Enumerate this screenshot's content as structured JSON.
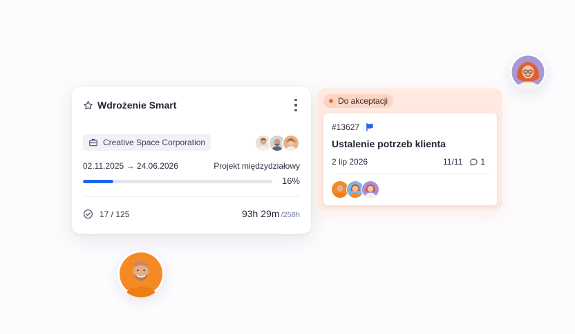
{
  "project": {
    "title": "Wdrożenie Smart",
    "client": "Creative Space Corporation",
    "dates": "02.11.2025 → 24.06.2026",
    "department": "Projekt międzydziałowy",
    "progress_fraction": 0.16,
    "progress_label": "16%",
    "tasks": "17 / 125",
    "time_spent": "93h 29m",
    "time_total": "/258h",
    "icons": [
      "star-icon",
      "menu-kebab-icon",
      "briefcase-icon",
      "check-circle-icon"
    ],
    "accent_color": "#2165e8"
  },
  "status_column": {
    "label": "Do akceptacji",
    "dot_color": "#f26a1b",
    "background": "#ffe9e0"
  },
  "task": {
    "id": "#13627",
    "title": "Ustalenie potrzeb klienta",
    "date": "2 lip 2026",
    "subtasks": "11/11",
    "comments": "1",
    "icons": [
      "flag-icon",
      "comment-icon"
    ],
    "flag_color": "#2165e8"
  }
}
